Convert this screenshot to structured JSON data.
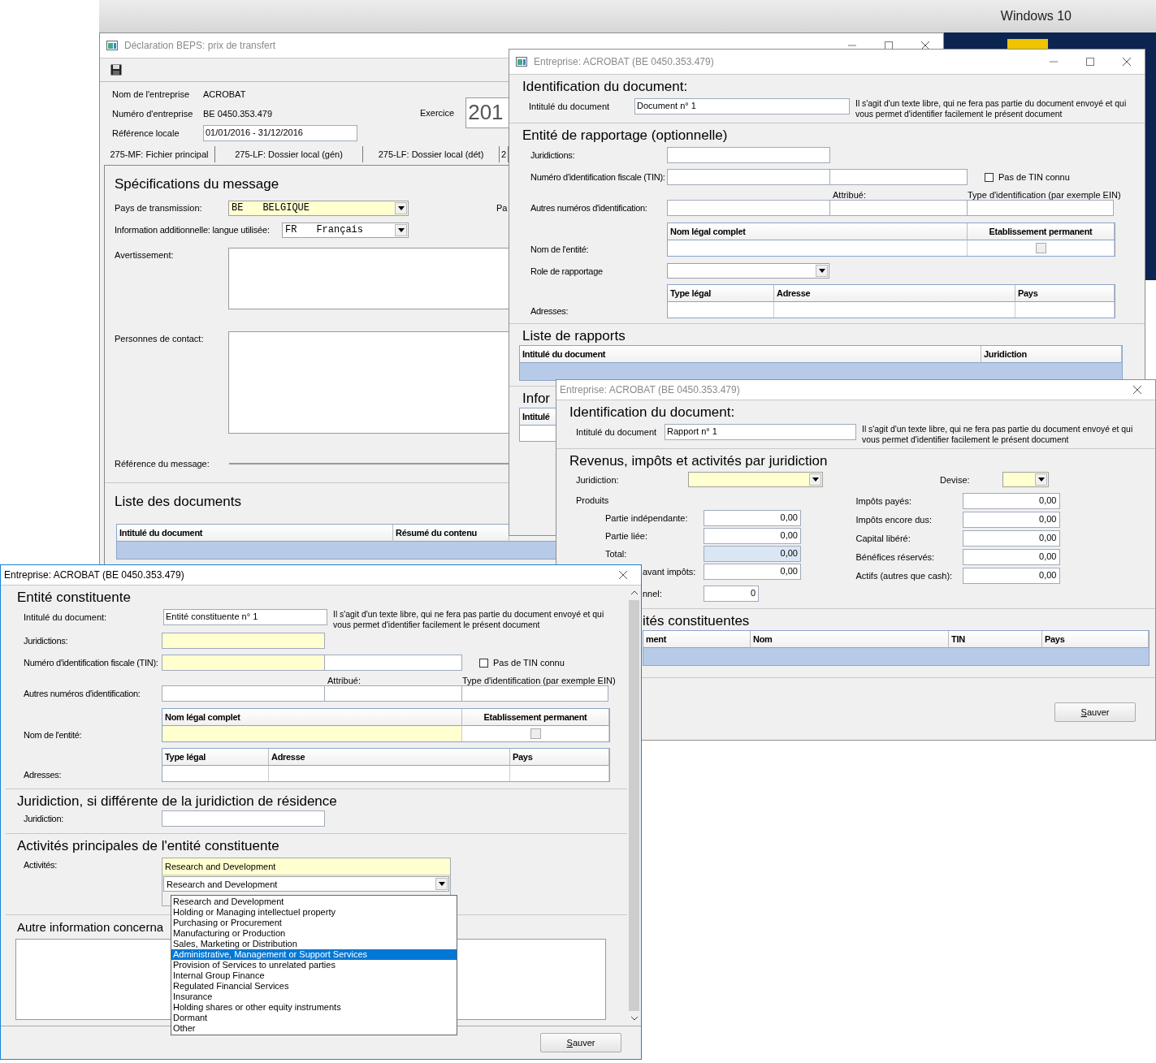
{
  "desktop": {
    "label": "Windows 10"
  },
  "main_window": {
    "title": "Déclaration BEPS: prix de transfert",
    "company": [
      {
        "label": "Nom de l'entreprise",
        "value": "ACROBAT"
      },
      {
        "label": "Numéro d'entreprise",
        "value": "BE 0450.353.479"
      }
    ],
    "exercise": {
      "label": "Exercice",
      "value": "201"
    },
    "local_reference": {
      "label": "Référence locale",
      "value": "01/01/2016 - 31/12/2016"
    },
    "tabs": [
      {
        "label": "275-MF: Fichier principal",
        "selected": false
      },
      {
        "label": "275-LF: Dossier local (gén)",
        "selected": false
      },
      {
        "label": "275-LF: Dossier local (dét)",
        "selected": false
      },
      {
        "label": "2",
        "selected": false
      }
    ],
    "message": {
      "title": "Spécifications du message",
      "country": {
        "label": "Pays de transmission:",
        "code": "BE",
        "name": "BELGIQUE",
        "required": true
      },
      "country_cut_label": "Pa",
      "language": {
        "label": "Information additionnelle: langue utilisée:",
        "code": "FR",
        "name": "Français",
        "required": false
      },
      "warning_label": "Avertissement:",
      "contacts_label": "Personnes de contact:",
      "reference_label": "Référence du message:"
    },
    "documents": {
      "title": "Liste des documents",
      "columns": [
        "Intitulé du document",
        "Résumé du contenu"
      ]
    }
  },
  "document_window": {
    "title": "Entreprise: ACROBAT (BE 0450.353.479)",
    "heading": "Identification du document:",
    "doc_title": {
      "label": "Intitulé du document",
      "value": "Document n° 1"
    },
    "hint": "Il s'agit d'un texte libre, qui ne fera pas partie du document envoyé et qui vous permet d'identifier facilement le présent document",
    "reporting": {
      "title": "Entité de rapportage (optionnelle)",
      "jurisdictions": {
        "label": "Juridictions:",
        "required": false
      },
      "tin": {
        "label": "Numéro d'identification fiscale (TIN):",
        "required": false
      },
      "no_tin": {
        "label": "Pas de TIN connu",
        "checked": false
      },
      "attributed_label": "Attribué:",
      "id_type_label": "Type d'identification (par exemple EIN)",
      "other_ids_label": "Autres numéros d'identification:",
      "entity_label": "Nom de l'entité:",
      "entity_columns": [
        "Nom légal complet",
        "Etablissement permanent"
      ],
      "legal_name_required": false,
      "permanent": {
        "checked": false
      },
      "role_label": "Role de rapportage",
      "addresses_label": "Adresses:",
      "address_columns": [
        "Type légal",
        "Adresse",
        "Pays"
      ]
    },
    "reports": {
      "title": "Liste de rapports",
      "columns": [
        "Intitulé du document",
        "Juridiction"
      ]
    },
    "cut_heading": "Infor",
    "cut_column": "Intitulé"
  },
  "report_window": {
    "title": "Entreprise: ACROBAT (BE 0450.353.479)",
    "heading": "Identification du document:",
    "doc_title": {
      "label": "Intitulé du document",
      "value": "Rapport n° 1"
    },
    "hint": "Il s'agit d'un texte libre, qui ne fera pas partie du document envoyé et qui vous permet d'identifier facilement le présent document",
    "section_title": "Revenus, impôts et activités par juridiction",
    "jurisdiction_label": "Juridiction:",
    "currency_label": "Devise:",
    "products_label": "Produits",
    "left_fields": [
      {
        "label": "Partie indépendante:",
        "value": "0,00",
        "readonly": false,
        "kind": "amount"
      },
      {
        "label": "Partie liée:",
        "value": "0,00",
        "readonly": false,
        "kind": "amount"
      },
      {
        "label": "Total:",
        "value": "0,00",
        "readonly": true,
        "kind": "amount"
      },
      {
        "label": "avant impôts:",
        "value": "0,00",
        "readonly": false,
        "kind": "cut"
      },
      {
        "label": "nnel:",
        "value": "0",
        "readonly": false,
        "kind": "count"
      }
    ],
    "right_fields": [
      {
        "label": "Impôts payés:",
        "value": "0,00"
      },
      {
        "label": "Impôts encore dus:",
        "value": "0,00"
      },
      {
        "label": "Capital libéré:",
        "value": "0,00"
      },
      {
        "label": "Bénéfices réservés:",
        "value": "0,00"
      },
      {
        "label": "Actifs (autres que cash):",
        "value": "0,00"
      }
    ],
    "entities": {
      "title": "ités constituentes",
      "columns": [
        "ment",
        "Nom",
        "TIN",
        "Pays"
      ]
    },
    "save_button": "Sauver"
  },
  "entity_window": {
    "title": "Entreprise: ACROBAT (BE 0450.353.479)",
    "heading": "Entité constituente",
    "doc_title": {
      "label": "Intitulé du document:",
      "value": "Entité constituente n° 1"
    },
    "hint": "Il s'agit d'un texte libre, qui ne fera pas partie du document envoyé et qui vous permet d'identifier facilement le présent document",
    "entity": {
      "jurisdictions": {
        "label": "Juridictions:",
        "required": true
      },
      "tin": {
        "label": "Numéro d'identification fiscale (TIN):",
        "required": true
      },
      "no_tin": {
        "label": "Pas de TIN connu",
        "checked": false
      },
      "attributed_label": "Attribué:",
      "id_type_label": "Type d'identification (par exemple EIN)",
      "other_ids_label": "Autres numéros d'identification:",
      "entity_label": "Nom de l'entité:",
      "entity_columns": [
        "Nom légal complet",
        "Etablissement permanent"
      ],
      "legal_name_required": true,
      "permanent": {
        "checked": false
      },
      "addresses_label": "Adresses:",
      "address_columns": [
        "Type légal",
        "Adresse",
        "Pays"
      ]
    },
    "residence": {
      "title": "Juridiction, si différente de la juridiction de résidence",
      "label": "Juridiction:"
    },
    "activities": {
      "title": "Activités principales de l'entité constituente",
      "label": "Activités:",
      "items": [
        "Research and Development"
      ],
      "combo_value": "Research and Development",
      "options": [
        {
          "label": "Research and Development",
          "selected": false
        },
        {
          "label": "Holding or Managing intellectuel property",
          "selected": false
        },
        {
          "label": "Purchasing or Procurement",
          "selected": false
        },
        {
          "label": "Manufacturing or Production",
          "selected": false
        },
        {
          "label": "Sales, Marketing or Distribution",
          "selected": false
        },
        {
          "label": "Administrative, Management or Support Services",
          "selected": true
        },
        {
          "label": "Provision of Services to unrelated parties",
          "selected": false
        },
        {
          "label": "Internal Group Finance",
          "selected": false
        },
        {
          "label": "Regulated Financial Services",
          "selected": false
        },
        {
          "label": "Insurance",
          "selected": false
        },
        {
          "label": "Holding shares or other equity instruments",
          "selected": false
        },
        {
          "label": "Dormant",
          "selected": false
        },
        {
          "label": "Other",
          "selected": false
        }
      ]
    },
    "other_info_title": "Autre information concerna",
    "save_button": "Sauver"
  }
}
